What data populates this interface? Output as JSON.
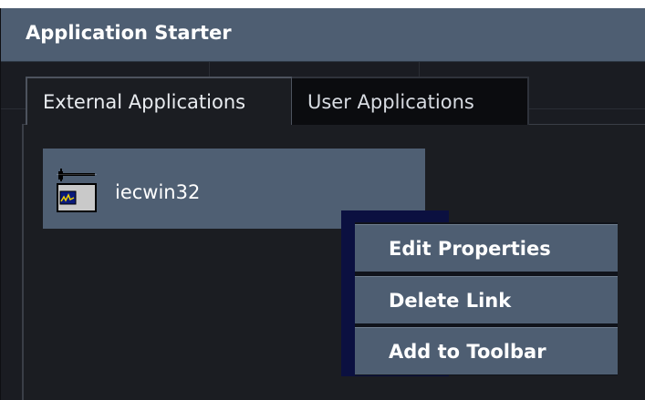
{
  "window": {
    "title": "Application Starter"
  },
  "tabs": [
    {
      "label": "External Applications",
      "active": true
    },
    {
      "label": "User Applications",
      "active": false
    }
  ],
  "applications": [
    {
      "label": "iecwin32",
      "icon": "iecwin32-app-icon"
    }
  ],
  "context_menu": {
    "items": [
      {
        "label": "Edit Properties"
      },
      {
        "label": "Delete Link"
      },
      {
        "label": "Add to Toolbar"
      }
    ]
  },
  "colors": {
    "titlebar": "#4e5e72",
    "menu_item": "#4e5e72",
    "tile": "#4f5f73",
    "background": "#1a1c22",
    "menu_shadow": "#0b1040"
  }
}
